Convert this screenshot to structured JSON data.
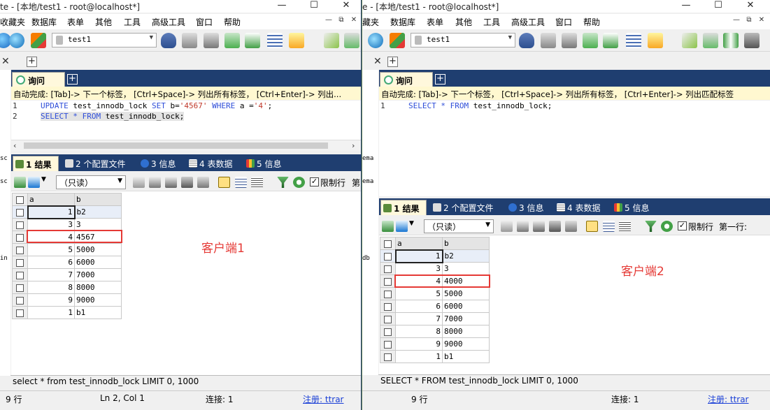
{
  "window1": {
    "title": "te - [本地/test1 - root@localhost*]",
    "menu": [
      "收藏夹",
      "数据库",
      "表单",
      "其他",
      "工具",
      "高级工具",
      "窗口",
      "帮助"
    ],
    "db_selected": "test1",
    "query_tab": "询问",
    "autocomplete_hint": "自动完成: [Tab]-> 下一个标签， [Ctrl+Space]-> 列出所有标签， [Ctrl+Enter]-> 列出...",
    "lines": [
      {
        "num": "1",
        "segments": [
          {
            "t": "UPDATE",
            "k": "kw"
          },
          {
            "t": " test_innodb_lock ",
            "k": ""
          },
          {
            "t": "SET",
            "k": "kw"
          },
          {
            "t": " b=",
            "k": ""
          },
          {
            "t": "'4567'",
            "k": "str"
          },
          {
            "t": " ",
            "k": ""
          },
          {
            "t": "WHERE",
            "k": "kw"
          },
          {
            "t": " a =",
            "k": ""
          },
          {
            "t": "'4'",
            "k": "str"
          },
          {
            "t": ";",
            "k": ""
          }
        ]
      },
      {
        "num": "2",
        "segments": [
          {
            "t": "SELECT",
            "k": "kw"
          },
          {
            "t": " ",
            "k": ""
          },
          {
            "t": "*",
            "k": "kw"
          },
          {
            "t": " ",
            "k": ""
          },
          {
            "t": "FROM",
            "k": "kw"
          },
          {
            "t": " test_innodb_lock;",
            "k": ""
          }
        ]
      }
    ],
    "result_tabs": [
      "1 结果",
      "2 个配置文件",
      "3 信息",
      "4 表数据",
      "5 信息"
    ],
    "mode": "（只读）",
    "limit_label": "限制行",
    "first_row_label": "第",
    "columns": [
      "a",
      "b"
    ],
    "rows": [
      [
        "1",
        "b2"
      ],
      [
        "3",
        "3"
      ],
      [
        "4",
        "4567"
      ],
      [
        "5",
        "5000"
      ],
      [
        "6",
        "6000"
      ],
      [
        "7",
        "7000"
      ],
      [
        "8",
        "8000"
      ],
      [
        "9",
        "9000"
      ],
      [
        "1",
        "b1"
      ]
    ],
    "client_label": "客户端1",
    "sql_status": "select * from test_innodb_lock LIMIT 0, 1000",
    "status": {
      "rows": "9 行",
      "pos": "Ln 2, Col 1",
      "conn": "连接: 1",
      "reg": "注册: ttrar"
    }
  },
  "window2": {
    "title": "e - [本地/test1 - root@localhost*]",
    "menu": [
      "藏夹",
      "数据库",
      "表单",
      "其他",
      "工具",
      "高级工具",
      "窗口",
      "帮助"
    ],
    "db_selected": "test1",
    "query_tab": "询问",
    "autocomplete_hint": "自动完成: [Tab]-> 下一个标签， [Ctrl+Space]-> 列出所有标签， [Ctrl+Enter]-> 列出匹配标签",
    "lines": [
      {
        "num": "1",
        "segments": [
          {
            "t": "SELECT",
            "k": "kw"
          },
          {
            "t": " ",
            "k": ""
          },
          {
            "t": "*",
            "k": "kw"
          },
          {
            "t": " ",
            "k": ""
          },
          {
            "t": "FROM",
            "k": "kw"
          },
          {
            "t": " test_innodb_lock;",
            "k": ""
          }
        ]
      }
    ],
    "result_tabs": [
      "1 结果",
      "2 个配置文件",
      "3 信息",
      "4 表数据",
      "5 信息"
    ],
    "mode": "（只读）",
    "limit_label": "限制行",
    "first_row_label": "第一行:",
    "columns": [
      "a",
      "b"
    ],
    "rows": [
      [
        "1",
        "b2"
      ],
      [
        "3",
        "3"
      ],
      [
        "4",
        "4000"
      ],
      [
        "5",
        "5000"
      ],
      [
        "6",
        "6000"
      ],
      [
        "7",
        "7000"
      ],
      [
        "8",
        "8000"
      ],
      [
        "9",
        "9000"
      ],
      [
        "1",
        "b1"
      ]
    ],
    "client_label": "客户端2",
    "sql_status": "SELECT * FROM test_innodb_lock LIMIT 0, 1000",
    "status": {
      "rows": "9 行",
      "pos": "",
      "conn": "连接: 1",
      "reg": "注册: ttrar"
    }
  },
  "side_fragments": [
    "ema",
    "ema",
    "db",
    "sc",
    "sc",
    "in"
  ],
  "colors": {
    "accent_dark": "#1f3e70",
    "highlight_red": "#e53935",
    "keyword_blue": "#2f4ed9",
    "string_red": "#c0392b",
    "tab_active": "#fff8dc"
  }
}
